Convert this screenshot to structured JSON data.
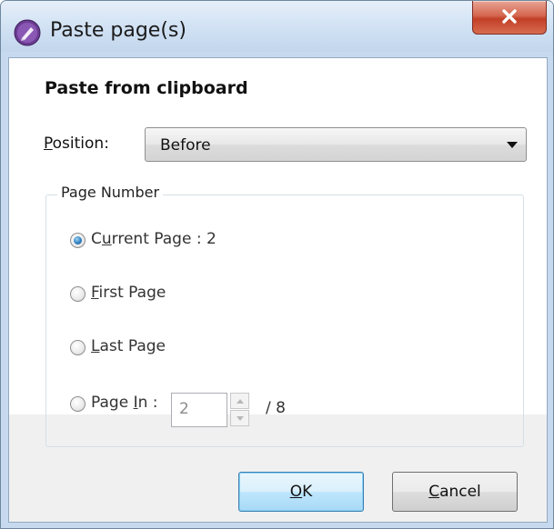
{
  "window": {
    "title": "Paste page(s)",
    "close_glyph": "X",
    "icon": "pen-nib-icon"
  },
  "dialog": {
    "heading": "Paste from clipboard",
    "position": {
      "label_first": "P",
      "label_rest": "osition:",
      "selected": "Before"
    },
    "page_number": {
      "group_label": "Page Number",
      "options": [
        {
          "first": "C",
          "first_underlined": false,
          "mid_u": "u",
          "rest": "rrent Page : 2",
          "checked": true
        },
        {
          "first": "F",
          "rest": "irst Page",
          "checked": false
        },
        {
          "first": "L",
          "rest": "ast Page",
          "checked": false
        },
        {
          "pre": "Page ",
          "u": "I",
          "rest": "n :",
          "checked": false
        }
      ],
      "page_in_value": "2",
      "total": "/ 8"
    },
    "buttons": {
      "ok_u": "O",
      "ok_rest": "K",
      "cancel_u": "C",
      "cancel_rest": "ancel"
    }
  },
  "colors": {
    "accent": "#3c7fb1",
    "close": "#c23f27"
  }
}
